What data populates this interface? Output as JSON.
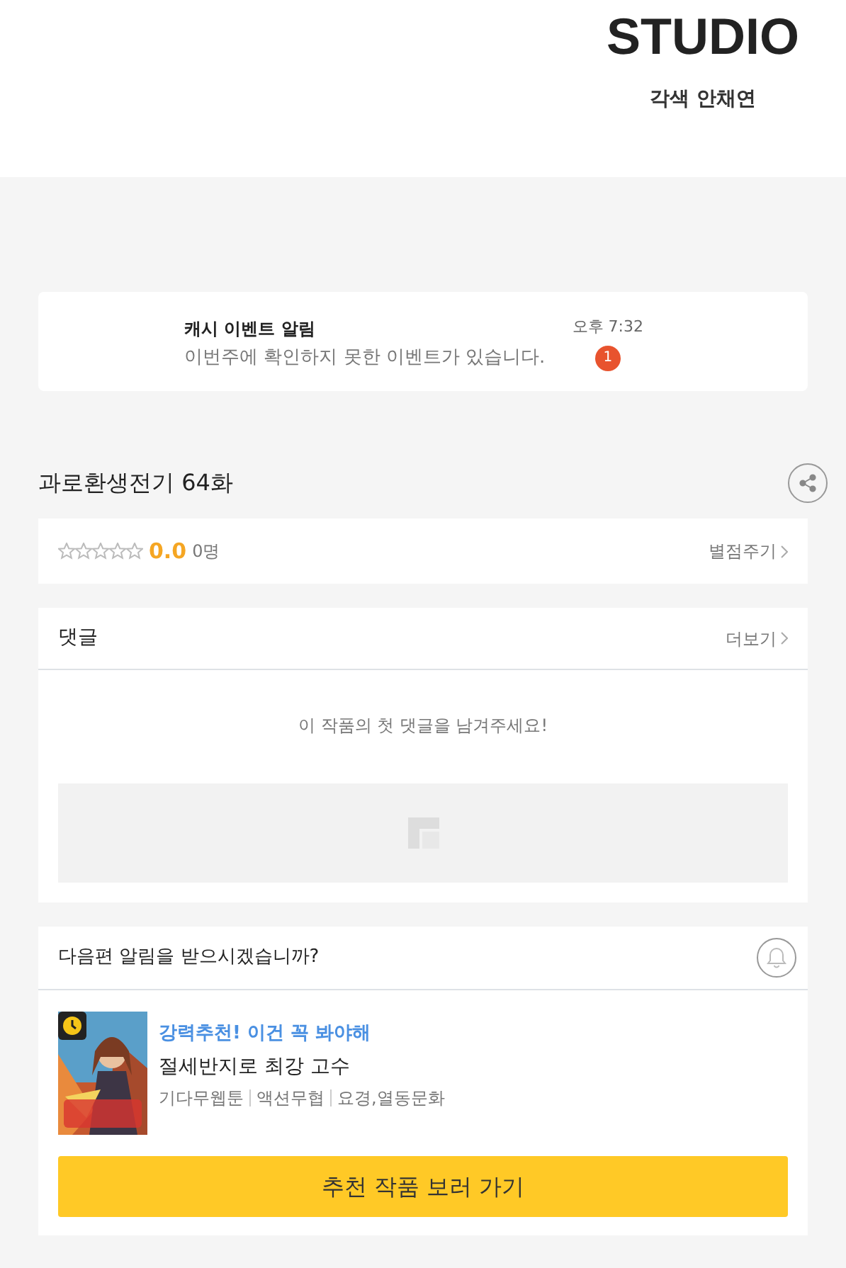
{
  "header": {
    "logo": "STUDIO",
    "credit": "각색 안채연"
  },
  "notification": {
    "title": "캐시 이벤트 알림",
    "message": "이번주에 확인하지 못한 이벤트가 있습니다.",
    "time": "오후 7:32",
    "count": "1"
  },
  "episode": {
    "title": "과로환생전기 64화"
  },
  "rating": {
    "stars": 0,
    "score": "0.0",
    "voters": "0명",
    "action": "별점주기"
  },
  "comments": {
    "title": "댓글",
    "more": "더보기",
    "empty": "이 작품의 첫 댓글을 남겨주세요!"
  },
  "next_alert": {
    "question": "다음편 알림을 받으시겠습니까?",
    "subscribed": false
  },
  "recommendation": {
    "tagline": "강력추천! 이건 꼭 봐야해",
    "title": "절세반지로 최강 고수",
    "tags": [
      "기다무웹툰",
      "액션무협",
      "요경,열동문화"
    ],
    "button": "추천 작품 보러 가기"
  }
}
